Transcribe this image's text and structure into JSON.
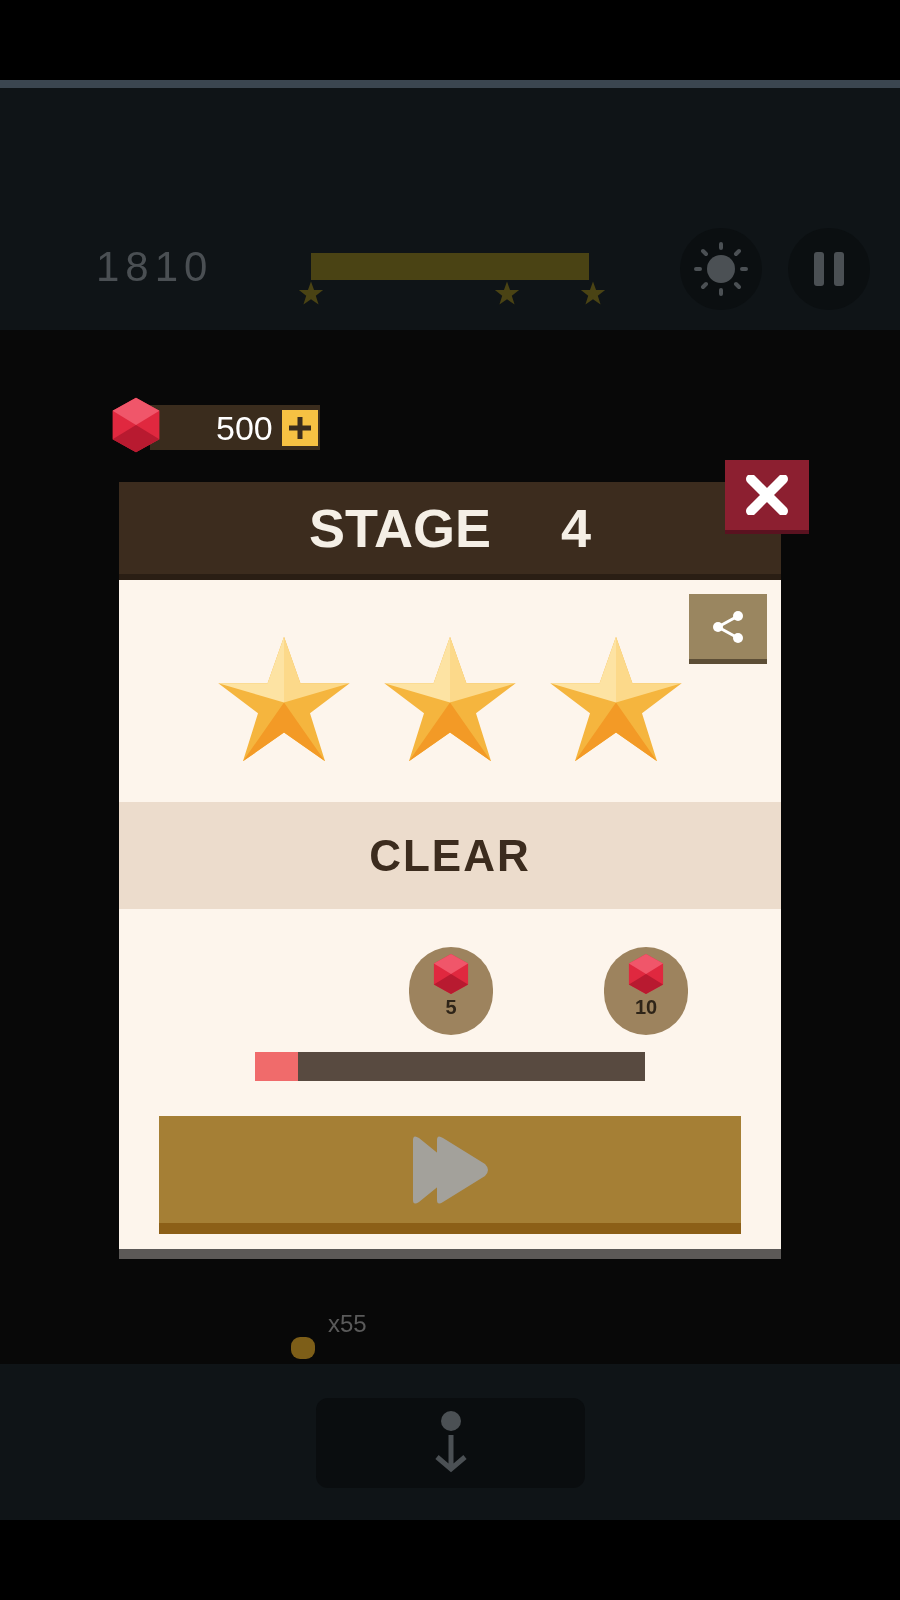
{
  "hud": {
    "score": "1810"
  },
  "gems": {
    "count": "500"
  },
  "dialog": {
    "title": "STAGE",
    "stage": "4",
    "stars": 3,
    "result": "CLEAR",
    "rewards": [
      {
        "amount": "5"
      },
      {
        "amount": "10"
      }
    ],
    "reward_progress": {
      "level": 0.11
    }
  },
  "footer": {
    "count": "x55"
  }
}
